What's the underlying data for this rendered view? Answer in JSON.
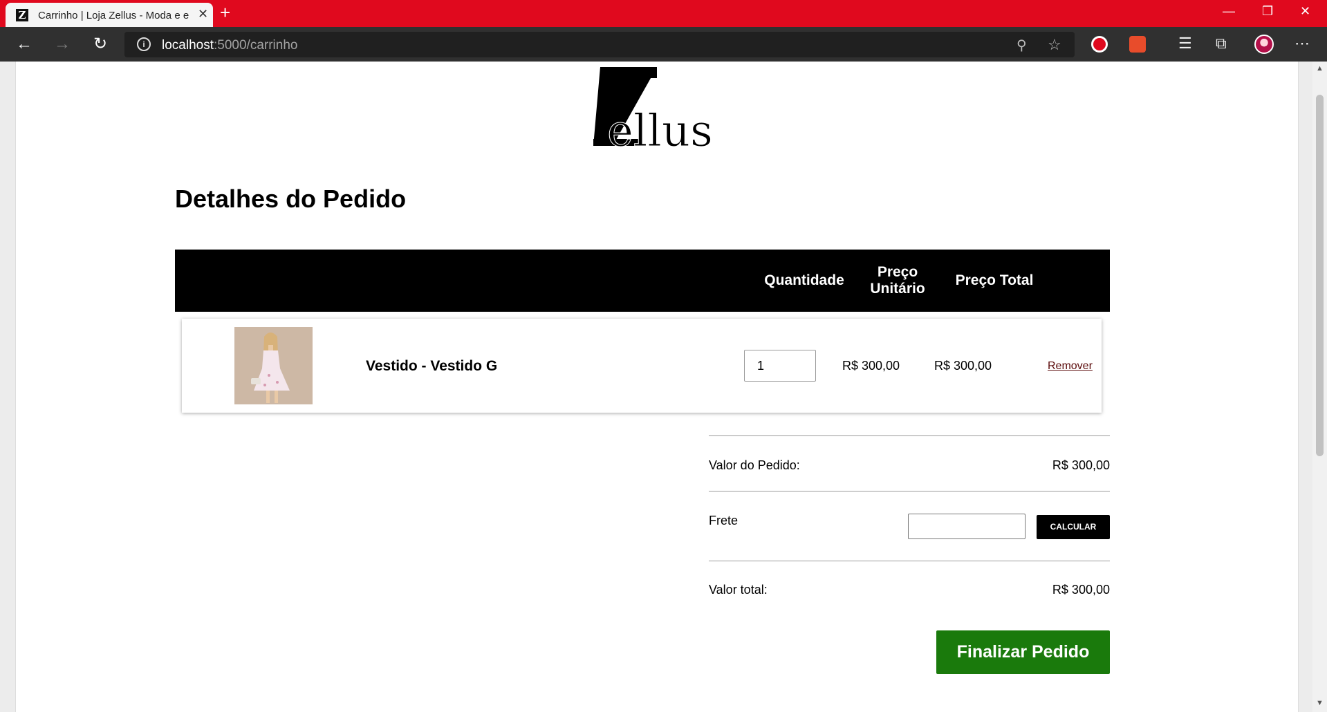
{
  "browser": {
    "tab_title": "Carrinho | Loja Zellus - Moda e e",
    "favicon_letter": "Z",
    "url_host": "localhost",
    "url_path": ":5000/carrinho"
  },
  "page": {
    "logo_text": "Zellus",
    "heading": "Detalhes do Pedido",
    "table_headers": {
      "quantity": "Quantidade",
      "unit_price_line1": "Preço",
      "unit_price_line2": "Unitário",
      "total_price": "Preço Total"
    },
    "cart_items": [
      {
        "name": "Vestido - Vestido G",
        "quantity": "1",
        "unit_price": "R$ 300,00",
        "total_price": "R$ 300,00",
        "remove_label": "Remover"
      }
    ],
    "summary": {
      "order_value_label": "Valor do Pedido:",
      "order_value": "R$ 300,00",
      "shipping_label": "Frete",
      "shipping_input_value": "",
      "calculate_label": "CALCULAR",
      "total_label": "Valor total:",
      "total_value": "R$ 300,00"
    },
    "finish_label": "Finalizar Pedido"
  },
  "colors": {
    "tabbar": "#e0091e",
    "finish_button": "#1a7a0c",
    "table_header": "#000000",
    "remove_link": "#5a0a0a"
  }
}
